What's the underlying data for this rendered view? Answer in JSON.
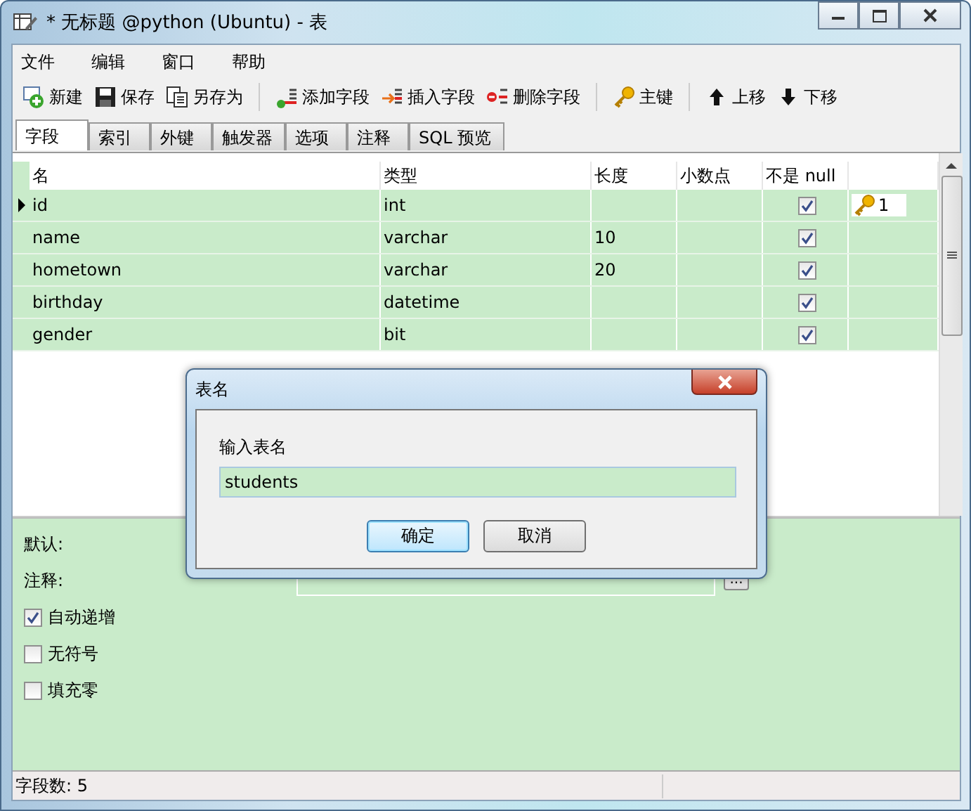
{
  "window": {
    "title": "* 无标题 @python (Ubuntu) - 表"
  },
  "menu": [
    "文件",
    "编辑",
    "窗口",
    "帮助"
  ],
  "toolbar": [
    {
      "kind": "new",
      "label": "新建"
    },
    {
      "kind": "save",
      "label": "保存"
    },
    {
      "kind": "saveas",
      "label": "另存为"
    },
    {
      "kind": "sep"
    },
    {
      "kind": "add",
      "label": "添加字段"
    },
    {
      "kind": "insert",
      "label": "插入字段"
    },
    {
      "kind": "delete",
      "label": "删除字段"
    },
    {
      "kind": "sep"
    },
    {
      "kind": "key",
      "label": "主键"
    },
    {
      "kind": "sep"
    },
    {
      "kind": "up",
      "label": "上移"
    },
    {
      "kind": "down",
      "label": "下移"
    }
  ],
  "tabs": [
    {
      "label": "字段",
      "selected": true
    },
    {
      "label": "索引",
      "selected": false
    },
    {
      "label": "外键",
      "selected": false
    },
    {
      "label": "触发器",
      "selected": false
    },
    {
      "label": "选项",
      "selected": false
    },
    {
      "label": "注释",
      "selected": false
    },
    {
      "label": "SQL 预览",
      "selected": false
    }
  ],
  "table": {
    "columns": [
      "名",
      "类型",
      "长度",
      "小数点",
      "不是 null"
    ],
    "rows": [
      {
        "name": "id",
        "type": "int",
        "length": "",
        "not_null": true,
        "current": true,
        "key": "1"
      },
      {
        "name": "name",
        "type": "varchar",
        "length": "10",
        "not_null": true,
        "current": false
      },
      {
        "name": "hometown",
        "type": "varchar",
        "length": "20",
        "not_null": true,
        "current": false
      },
      {
        "name": "birthday",
        "type": "datetime",
        "length": "",
        "not_null": true,
        "current": false
      },
      {
        "name": "gender",
        "type": "bit",
        "length": "",
        "not_null": true,
        "current": false
      }
    ]
  },
  "properties": {
    "default_label": "默认:",
    "comment_label": "注释:",
    "comment_button": "...",
    "checkboxes": [
      {
        "label": "自动递增",
        "checked": true
      },
      {
        "label": "无符号",
        "checked": false
      },
      {
        "label": "填充零",
        "checked": false
      }
    ]
  },
  "status_bar": "字段数: 5",
  "dialog": {
    "title": "表名",
    "label": "输入表名",
    "value": "students",
    "buttons": [
      {
        "label": "确定",
        "default": true
      },
      {
        "label": "取消",
        "default": false
      }
    ]
  }
}
